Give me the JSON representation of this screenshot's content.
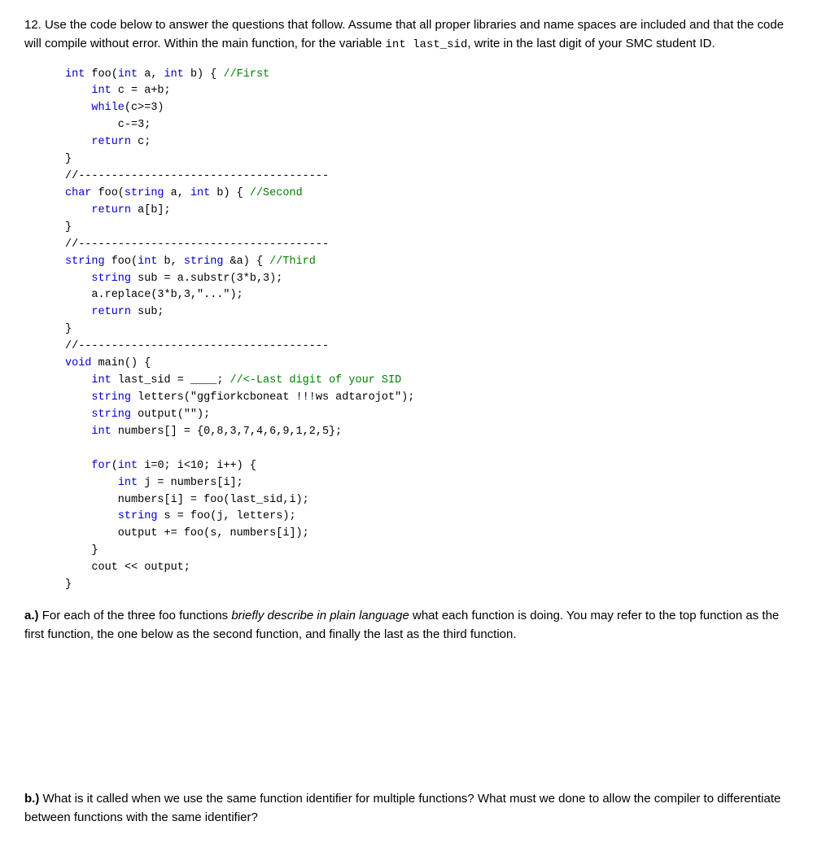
{
  "question": {
    "number": "12.",
    "intro": "Use the code below to answer the questions that follow.  Assume that all proper libraries and name spaces are included and that the code will compile without error.  Within the main function, for the variable",
    "inline_code": "int last_sid",
    "intro2": ", write in the last digit of your SMC student ID.",
    "part_a_label": "a.)",
    "part_a_text": "For each of the three foo functions ",
    "part_a_italic": "briefly describe in plain language",
    "part_a_text2": " what each function is doing.  You may refer to the top function as the first function, the one below as the second function, and finally the last as the third function.",
    "part_b_label": "b.)",
    "part_b_text": "What is it called when we use the same function identifier for multiple functions? What must we done to allow the compiler to differentiate between functions with the same identifier?"
  },
  "code": {
    "lines": [
      {
        "text": "int foo(int a, int b) { //First",
        "type": "mixed"
      },
      {
        "text": "    int c = a+b;",
        "type": "mixed"
      },
      {
        "text": "    while(c>=3)",
        "type": "mixed"
      },
      {
        "text": "        c-=3;",
        "type": "normal"
      },
      {
        "text": "    return c;",
        "type": "mixed"
      },
      {
        "text": "}",
        "type": "normal"
      },
      {
        "text": "//--------------------------------------",
        "type": "divider"
      },
      {
        "text": "char foo(string a, int b) { //Second",
        "type": "mixed"
      },
      {
        "text": "    return a[b];",
        "type": "mixed"
      },
      {
        "text": "}",
        "type": "normal"
      },
      {
        "text": "//--------------------------------------",
        "type": "divider"
      },
      {
        "text": "string foo(int b, string &a) { //Third",
        "type": "mixed"
      },
      {
        "text": "    string sub = a.substr(3*b,3);",
        "type": "mixed"
      },
      {
        "text": "    a.replace(3*b,3,\"...\");",
        "type": "normal"
      },
      {
        "text": "    return sub;",
        "type": "mixed"
      },
      {
        "text": "}",
        "type": "normal"
      },
      {
        "text": "//--------------------------------------",
        "type": "divider"
      },
      {
        "text": "void main() {",
        "type": "mixed"
      },
      {
        "text": "    int last_sid = ____; //<-Last digit of your SID",
        "type": "mixed"
      },
      {
        "text": "    string letters(\"ggfiorkcboneat !!!ws adtarojot\");",
        "type": "mixed"
      },
      {
        "text": "    string output(\"\");",
        "type": "mixed"
      },
      {
        "text": "    int numbers[] = {0,8,3,7,4,6,9,1,2,5};",
        "type": "mixed"
      },
      {
        "text": "",
        "type": "blank"
      },
      {
        "text": "    for(int i=0; i<10; i++) {",
        "type": "mixed"
      },
      {
        "text": "        int j = numbers[i];",
        "type": "mixed"
      },
      {
        "text": "        numbers[i] = foo(last_sid,i);",
        "type": "normal"
      },
      {
        "text": "        string s = foo(j, letters);",
        "type": "mixed"
      },
      {
        "text": "        output += foo(s, numbers[i]);",
        "type": "normal"
      },
      {
        "text": "    }",
        "type": "normal"
      },
      {
        "text": "    cout << output;",
        "type": "normal"
      },
      {
        "text": "}",
        "type": "normal"
      }
    ]
  }
}
